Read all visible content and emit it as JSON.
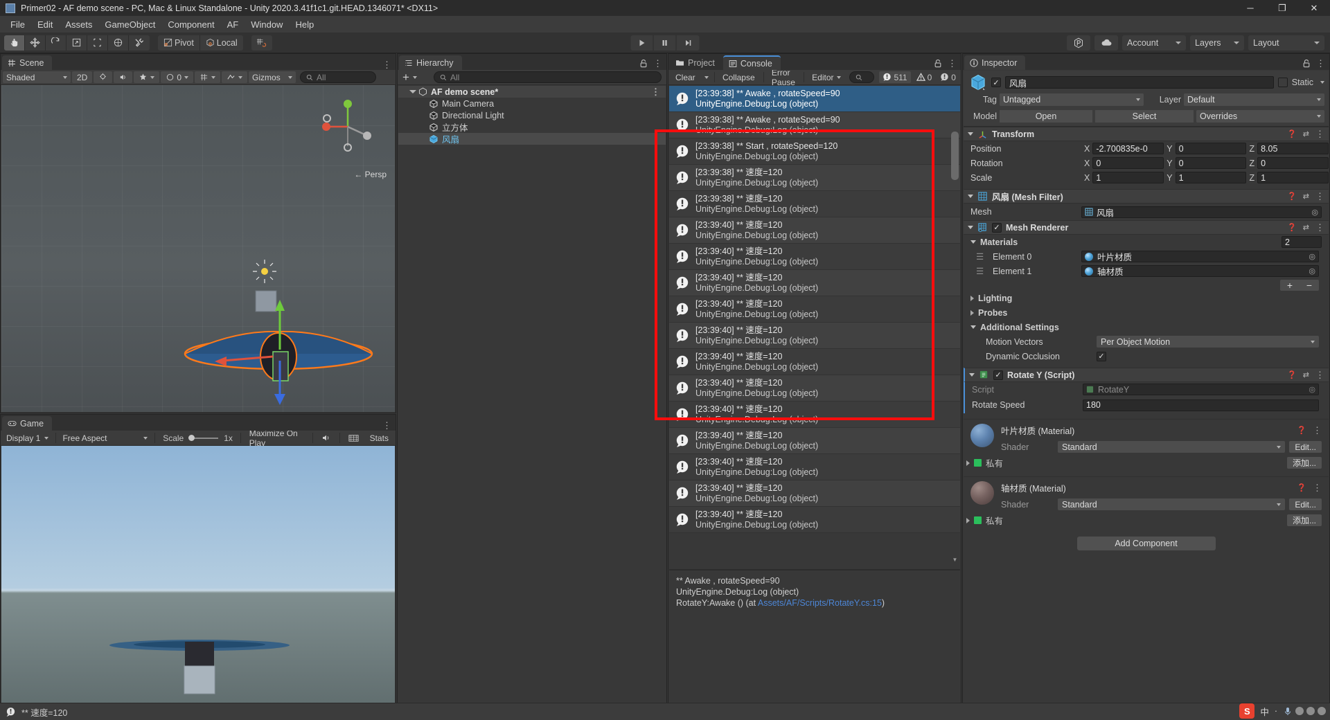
{
  "window": {
    "title": "Primer02 - AF demo scene - PC, Mac & Linux Standalone - Unity 2020.3.41f1c1.git.HEAD.1346071* <DX11>",
    "minimize": "─",
    "maximize": "❐",
    "close": "✕"
  },
  "menubar": {
    "items": [
      "File",
      "Edit",
      "Assets",
      "GameObject",
      "Component",
      "AF",
      "Window",
      "Help"
    ]
  },
  "toolbar": {
    "tools": [
      "hand-tool",
      "move-tool",
      "rotate-tool",
      "scale-tool",
      "rect-tool",
      "transform-tool",
      "custom-tool"
    ],
    "pivot_label": "Pivot",
    "local_label": "Local",
    "snap_label": "grid-snap",
    "play": "▶",
    "pause": "❙❙",
    "step": "▶❘",
    "cloud_label": "cloud-icon",
    "collab_label": "collab-icon",
    "account_label": "Account",
    "layers_label": "Layers",
    "layout_label": "Layout"
  },
  "scene": {
    "tab_label": "Scene",
    "shading_mode": "Shaded",
    "mode_2d": "2D",
    "gizmos_label": "Gizmos",
    "search_placeholder": "All",
    "perspective_label": "← Persp",
    "audio_toggle": "audio-icon",
    "fx_label": "fx-icon",
    "count_label": "0"
  },
  "game": {
    "tab_label": "Game",
    "display_label": "Display 1",
    "aspect_label": "Free Aspect",
    "scale_label": "Scale",
    "scale_value": "1x",
    "maximize_label": "Maximize On Play",
    "mute_label": "mute-audio-icon",
    "gizmos_label": "gizmos-icon",
    "stats_label": "Stats"
  },
  "hierarchy": {
    "tab_label": "Hierarchy",
    "add_label": "+",
    "search_placeholder": "All",
    "items": [
      {
        "label": "AF demo scene*",
        "type": "scene",
        "depth": 0,
        "selected": false
      },
      {
        "label": "Main Camera",
        "type": "gameobject",
        "depth": 1,
        "selected": false
      },
      {
        "label": "Directional Light",
        "type": "gameobject",
        "depth": 1,
        "selected": false
      },
      {
        "label": "立方体",
        "type": "gameobject",
        "depth": 1,
        "selected": false
      },
      {
        "label": "风扇",
        "type": "prefab",
        "depth": 1,
        "selected": true
      }
    ]
  },
  "console": {
    "project_tab_label": "Project",
    "console_tab_label": "Console",
    "clear_label": "Clear",
    "collapse_label": "Collapse",
    "error_pause_label": "Error Pause",
    "editor_label": "Editor",
    "search_placeholder": "",
    "counts": {
      "log": "511",
      "warning": "0",
      "error": "0"
    },
    "entries": [
      {
        "line1": "[23:39:38] **  Awake , rotateSpeed=90",
        "line2": "UnityEngine.Debug:Log (object)",
        "selected": true
      },
      {
        "line1": "[23:39:38] **  Awake , rotateSpeed=90",
        "line2": "UnityEngine.Debug:Log (object)",
        "selected": false
      },
      {
        "line1": "[23:39:38] **  Start , rotateSpeed=120",
        "line2": "UnityEngine.Debug:Log (object)",
        "selected": false
      },
      {
        "line1": "[23:39:38] ** 速度=120",
        "line2": "UnityEngine.Debug:Log (object)",
        "selected": false
      },
      {
        "line1": "[23:39:38] ** 速度=120",
        "line2": "UnityEngine.Debug:Log (object)",
        "selected": false
      },
      {
        "line1": "[23:39:40] ** 速度=120",
        "line2": "UnityEngine.Debug:Log (object)",
        "selected": false
      },
      {
        "line1": "[23:39:40] ** 速度=120",
        "line2": "UnityEngine.Debug:Log (object)",
        "selected": false
      },
      {
        "line1": "[23:39:40] ** 速度=120",
        "line2": "UnityEngine.Debug:Log (object)",
        "selected": false
      },
      {
        "line1": "[23:39:40] ** 速度=120",
        "line2": "UnityEngine.Debug:Log (object)",
        "selected": false
      },
      {
        "line1": "[23:39:40] ** 速度=120",
        "line2": "UnityEngine.Debug:Log (object)",
        "selected": false
      },
      {
        "line1": "[23:39:40] ** 速度=120",
        "line2": "UnityEngine.Debug:Log (object)",
        "selected": false
      },
      {
        "line1": "[23:39:40] ** 速度=120",
        "line2": "UnityEngine.Debug:Log (object)",
        "selected": false
      },
      {
        "line1": "[23:39:40] ** 速度=120",
        "line2": "UnityEngine.Debug:Log (object)",
        "selected": false
      },
      {
        "line1": "[23:39:40] ** 速度=120",
        "line2": "UnityEngine.Debug:Log (object)",
        "selected": false
      },
      {
        "line1": "[23:39:40] ** 速度=120",
        "line2": "UnityEngine.Debug:Log (object)",
        "selected": false
      },
      {
        "line1": "[23:39:40] ** 速度=120",
        "line2": "UnityEngine.Debug:Log (object)",
        "selected": false
      },
      {
        "line1": "[23:39:40] ** 速度=120",
        "line2": "UnityEngine.Debug:Log (object)",
        "selected": false
      }
    ],
    "detail": {
      "line1": "**  Awake , rotateSpeed=90",
      "line2": "UnityEngine.Debug:Log (object)",
      "line3_prefix": "RotateY:Awake () (at ",
      "line3_link": "Assets/AF/Scripts/RotateY.cs:15",
      "line3_suffix": ")"
    }
  },
  "inspector": {
    "tab_label": "Inspector",
    "object_name": "风扇",
    "enabled": true,
    "static_label": "Static",
    "tag_label": "Tag",
    "tag_value": "Untagged",
    "layer_label": "Layer",
    "layer_value": "Default",
    "model_label": "Model",
    "open_label": "Open",
    "select_label": "Select",
    "overrides_label": "Overrides",
    "transform": {
      "title": "Transform",
      "position_label": "Position",
      "position": {
        "x": "-2.700835e-0",
        "y": "0",
        "z": "8.05"
      },
      "rotation_label": "Rotation",
      "rotation": {
        "x": "0",
        "y": "0",
        "z": "0"
      },
      "scale_label": "Scale",
      "scale": {
        "x": "1",
        "y": "1",
        "z": "1"
      }
    },
    "mesh_filter": {
      "title": "风扇 (Mesh Filter)",
      "mesh_label": "Mesh",
      "mesh_value": "风扇"
    },
    "mesh_renderer": {
      "title": "Mesh Renderer",
      "enabled": true,
      "materials_label": "Materials",
      "materials_count": "2",
      "elements": [
        {
          "label": "Element 0",
          "value": "叶片材质"
        },
        {
          "label": "Element 1",
          "value": "轴材质"
        }
      ],
      "lighting_label": "Lighting",
      "probes_label": "Probes",
      "additional_settings_label": "Additional Settings",
      "motion_vectors_label": "Motion Vectors",
      "motion_vectors_value": "Per Object Motion",
      "dynamic_occlusion_label": "Dynamic Occlusion",
      "dynamic_occlusion": true
    },
    "script": {
      "title": "Rotate Y (Script)",
      "enabled": true,
      "script_label": "Script",
      "script_value": "RotateY",
      "rotate_speed_label": "Rotate Speed",
      "rotate_speed_value": "180"
    },
    "materials": [
      {
        "title": "叶片材质 (Material)",
        "shader_label": "Shader",
        "shader_value": "Standard",
        "edit_label": "Edit...",
        "private_label": "私有",
        "add_label": "添加..."
      },
      {
        "title": "轴材质 (Material)",
        "shader_label": "Shader",
        "shader_value": "Standard",
        "edit_label": "Edit...",
        "private_label": "私有",
        "add_label": "添加..."
      }
    ],
    "add_component_label": "Add Component"
  },
  "statusbar": {
    "message": "** 速度=120"
  },
  "ime": {
    "logo": "S",
    "mode": "中",
    "dot": "·",
    "tray_label": "语音输入"
  },
  "colors": {
    "accent_blue": "#4a90d9",
    "selection_blue": "#2f5e86",
    "highlight_red": "#ff0d0d",
    "panel_bg": "#383838",
    "toolbar_bg": "#3c3c3c"
  }
}
